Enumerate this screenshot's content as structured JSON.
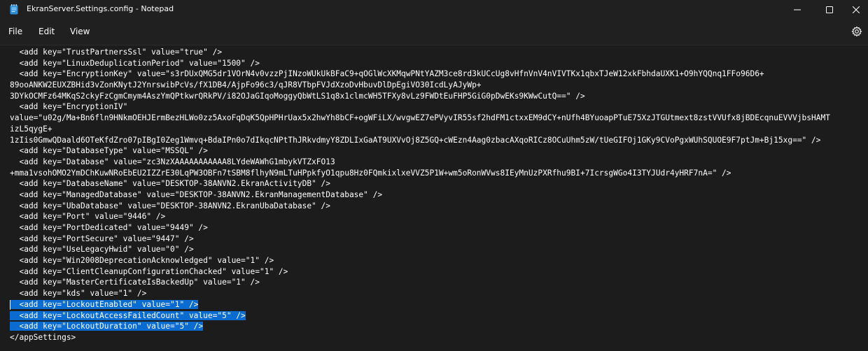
{
  "window": {
    "title": "EkranServer.Settings.config - Notepad"
  },
  "menu": {
    "file": "File",
    "edit": "Edit",
    "view": "View"
  },
  "icons": {
    "app": "notepad-icon",
    "minimize": "minimize-icon",
    "maximize": "maximize-icon",
    "close": "close-icon",
    "settings": "gear-icon"
  },
  "colors": {
    "background": "#1c1c1c",
    "chrome": "#202020",
    "selection": "#0a6cd0",
    "text": "#ffffff"
  },
  "editor": {
    "lines": [
      "  <add key=\"TrustPartnersSsl\" value=\"true\" />",
      "  <add key=\"LinuxDeduplicationPeriod\" value=\"1500\" />",
      "  <add key=\"EncryptionKey\" value=\"s3rDUxQMG5dr1VOrN4v0vzzPjINzoWUkUkBFaC9+qOGlWcXKMqwPNtYAZM3ce8rd3kUCcUg8vHfnVnV4nVIVTKx1qbxTJeW12xkFbhdaUXK1+O9hYQQnq1FFo96D6+",
      "89ooANKW2EUXZBHid3vZonKNytJ2YnrswibPcVs/fX1DB4/AjpFo96c3/qJR8VTbpFVJdXzoDvHbuvDlDpEgiVO30IcdLyAJyWp+",
      "3DYkOCMFz64MKqS2ckyFzCgmCmym4AszYmQPtkwrQRkPV/i82OJaGIqoMoggyQbWtLS1q8x1clmcWH5TFXy8vLz9FWDtEuFHP5GiG0pDwEKs9KWwCutQ==\" />",
      "  <add key=\"EncryptionIV\"",
      "value=\"u02g/Ma+Bn6fln9HNkmOEHJErmBezHLWo0zz5AxoFqDqK5QpHPHrUax5x2hwYh8bCF+ogWFiLX/wvgwEZ7ePVyvIR55sf2hdFM1ctxxEM9dCY+nUfh4BYuoapPTuE75XzJTGUtmext8zstVVUfx8jBDEcqnuEVVVjbsHAMT",
      "izL5qygE+",
      "1zIis0GmwQDaald6OTeKfdZro07pIBgI0Zeg1Wmvq+BdaIPn0o7dIkqcNPtThJRkvdmyY8ZDLIxGaAT9UXVvOj8Z5GQ+cWEzn4Aag0zbacAXqoRICz8OCuUhm5zW/tUeGIFOj1GKy9CVoPgxWUhSQUOE9F7ptJm+Bj15xg==\" />",
      "  <add key=\"DatabaseType\" value=\"MSSQL\" />",
      "  <add key=\"Database\" value=\"zc3NzXAAAAAAAAAAA8LYdeWAWhG1mbykVTZxFO13",
      "+mma1vsohOMO2YmDChKuwNRoEbEU2IZZrE30LqPW3OBFn7tSBM8flhyN9mLTuHPpkfyO1qpu8Hz0FQmkixlxeVVZ5P1W+wm5oRonWVws8IEyMnUzPXRfhu9BI+7IcrsgWGo4I3TYJUdr4yHRF7nA=\" />",
      "  <add key=\"DatabaseName\" value=\"DESKTOP-38ANVN2.EkranActivityDB\" />",
      "  <add key=\"ManagedDatabase\" value=\"DESKTOP-38ANVN2.EkranManagementDatabase\" />",
      "  <add key=\"UbaDatabase\" value=\"DESKTOP-38ANVN2.EkranUbaDatabase\" />",
      "  <add key=\"Port\" value=\"9446\" />",
      "  <add key=\"PortDedicated\" value=\"9449\" />",
      "  <add key=\"PortSecure\" value=\"9447\" />",
      "  <add key=\"UseLegacyHwid\" value=\"0\" />",
      "  <add key=\"Win2008DeprecationAcknowledged\" value=\"1\" />",
      "  <add key=\"ClientCleanupConfigurationChacked\" value=\"1\" />",
      "  <add key=\"MasterCertificateIsBackedUp\" value=\"1\" />",
      "  <add key=\"kds\" value=\"1\" />"
    ],
    "selected_lines": [
      "  <add key=\"LockoutEnabled\" value=\"1\" />",
      "  <add key=\"LockoutAccessFailedCount\" value=\"5\" />",
      "  <add key=\"LockoutDuration\" value=\"5\" />"
    ],
    "closing_line": "</appSettings>"
  }
}
